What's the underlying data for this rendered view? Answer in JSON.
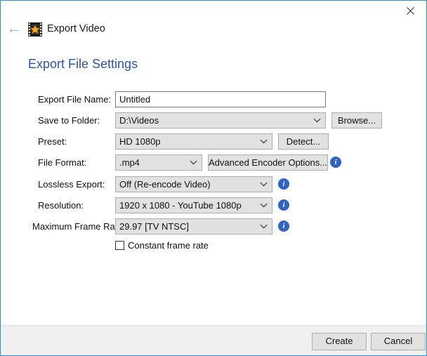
{
  "window": {
    "title": "Export Video",
    "app_icon": "film-star-icon",
    "back_icon": "back-arrow-icon",
    "close_icon": "close-icon",
    "accent_border": "#2f8ed6"
  },
  "heading": "Export File Settings",
  "colors": {
    "heading": "#2a56a8",
    "info_badge": "#2f63c6",
    "control_bg": "#e1e1e1",
    "footer_bg": "#f0f0f0"
  },
  "form": {
    "rows": [
      {
        "label": "Export File Name:",
        "type": "text",
        "value": "Untitled",
        "placeholder": "Untitled"
      },
      {
        "label": "Save to Folder:",
        "type": "combo",
        "value": "D:\\Videos",
        "button": "Browse..."
      },
      {
        "label": "Preset:",
        "type": "combo",
        "value": "HD 1080p",
        "button": "Detect..."
      },
      {
        "label": "File Format:",
        "type": "combo",
        "value": ".mp4",
        "button": "Advanced Encoder Options...",
        "info": "i"
      },
      {
        "label": "Lossless Export:",
        "type": "combo",
        "value": "Off (Re-encode Video)",
        "info": "i"
      },
      {
        "label": "Resolution:",
        "type": "combo",
        "value": "1920 x 1080 - YouTube 1080p",
        "info": "i"
      },
      {
        "label": "Maximum Frame Rate:",
        "type": "combo",
        "value": "29.97 [TV NTSC]",
        "info": "i"
      }
    ],
    "checkbox": {
      "label": "Constant frame rate",
      "checked": false
    }
  },
  "footer": {
    "create_label": "Create",
    "cancel_label": "Cancel"
  }
}
